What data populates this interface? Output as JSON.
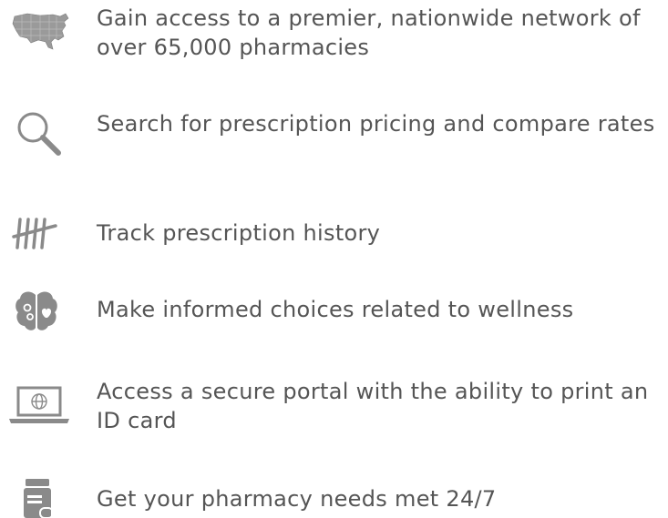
{
  "features": [
    {
      "icon": "us-map-icon",
      "text": "Gain access to a premier, nationwide network of over 65,000 pharmacies"
    },
    {
      "icon": "search-icon",
      "text": "Search for prescription pricing and compare rates"
    },
    {
      "icon": "tally-marks-icon",
      "text": "Track prescription history"
    },
    {
      "icon": "brain-icon",
      "text": "Make informed choices related to wellness"
    },
    {
      "icon": "laptop-globe-icon",
      "text": "Access a secure portal with the ability to print an ID card"
    },
    {
      "icon": "pill-bottle-icon",
      "text": "Get your pharmacy needs met 24/7"
    }
  ],
  "colors": {
    "text": "#555555",
    "icon": "#8a8a8a"
  }
}
